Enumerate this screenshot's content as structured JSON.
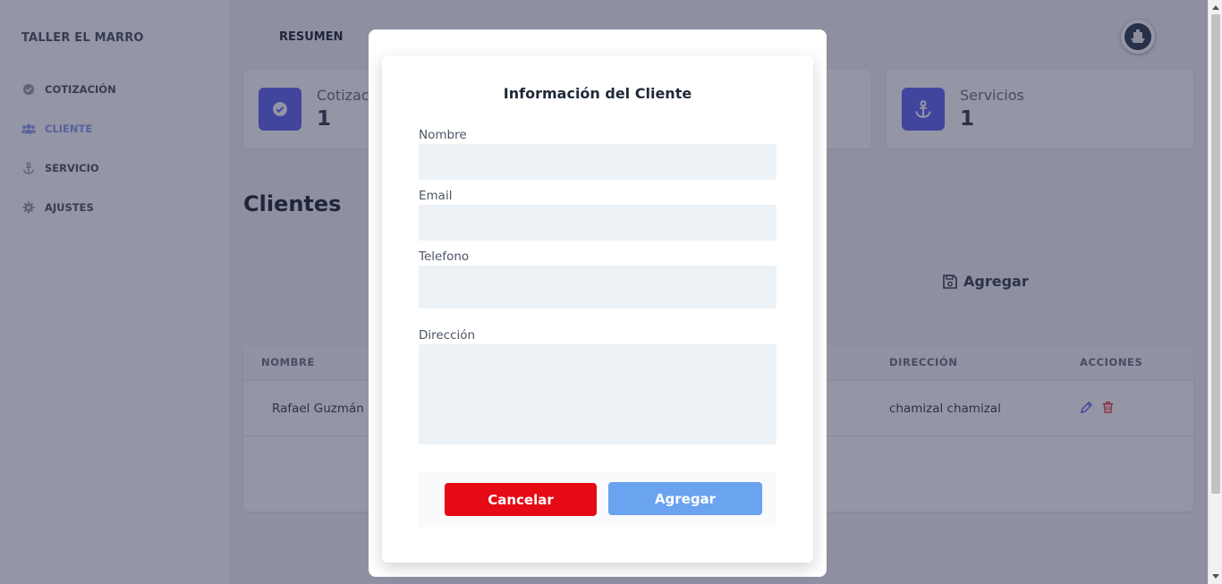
{
  "sidebar": {
    "brand": "TALLER EL MARRO",
    "items": [
      {
        "label": "COTIZACIÓN"
      },
      {
        "label": "CLIENTE"
      },
      {
        "label": "SERVICIO"
      },
      {
        "label": "AJUSTES"
      }
    ]
  },
  "topnav": {
    "label": "RESUMEN"
  },
  "cards": [
    {
      "label": "Cotizaciones",
      "value": "1"
    },
    {
      "label": "Servicios",
      "value": "1"
    }
  ],
  "section": {
    "title": "Clientes",
    "add_label": "Agregar"
  },
  "table": {
    "headers": {
      "nombre": "NOMBRE",
      "direccion": "DIRECCIÓN",
      "acciones": "ACCIONES"
    },
    "rows": [
      {
        "nombre": "Rafael Guzmán",
        "direccion": "chamizal chamizal"
      }
    ]
  },
  "modal": {
    "title": "Información del Cliente",
    "fields": {
      "nombre": {
        "label": "Nombre",
        "value": ""
      },
      "email": {
        "label": "Email",
        "value": ""
      },
      "telefono": {
        "label": "Telefono",
        "value": ""
      },
      "direccion": {
        "label": "Dirección",
        "value": ""
      }
    },
    "cancel_label": "Cancelar",
    "submit_label": "Agregar"
  },
  "colors": {
    "accent": "#6366f1",
    "cancel": "#e60a14",
    "submit": "#6aa3ef",
    "input_bg": "#edf2f7",
    "overlay": "rgba(31,33,66,0.48)"
  }
}
